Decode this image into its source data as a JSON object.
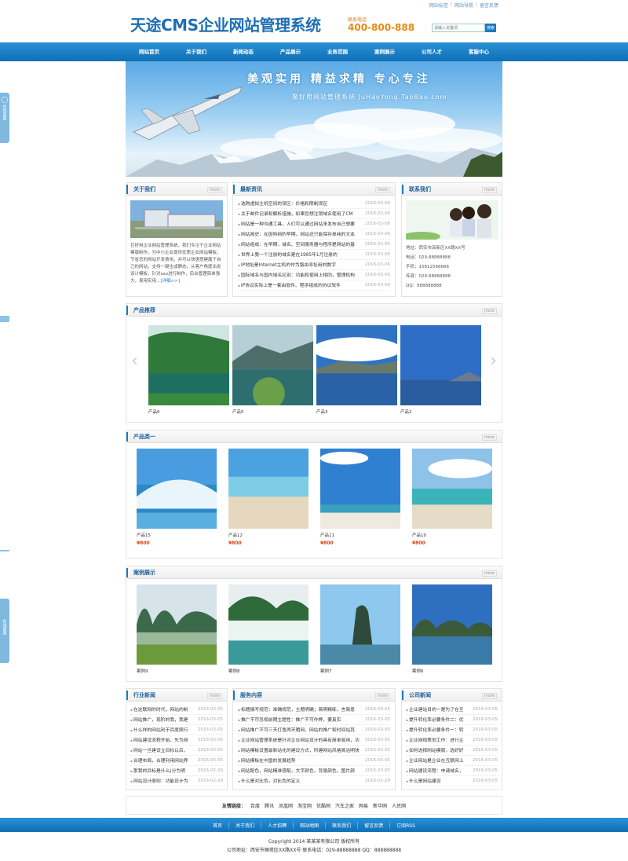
{
  "header": {
    "top_links": [
      "网站标签",
      "网站导航",
      "留言反馈"
    ],
    "logo": "天途CMS企业网站管理系统",
    "contact_label": "联系电话",
    "contact_phone": "400-800-888",
    "search_placeholder": "请输入关键词",
    "search_button": "搜索"
  },
  "nav": [
    "网站首页",
    "关于我们",
    "新闻动态",
    "产品展示",
    "业务范围",
    "案例展示",
    "公司人才",
    "客服中心"
  ],
  "banner": {
    "slogan": "美观实用  精益求精  专心专注",
    "sub": "聚好用网站管理系统  JuHaoYong.TaoBao.com"
  },
  "side_tabs": [
    "在线客服",
    "在线客服"
  ],
  "about": {
    "title": "关于我们",
    "more": "more",
    "text": "巨好用企业网站管理系统，我们专注于企业网站模版制作，为中小企业提供优质企业网站模板，节省您的网站开发费用，并可以快速搭建属于自己的网站，支持一键生成静态，从客户角度出发设计模板，针对seo进行制作，后台管理简单强大，易用实用…",
    "detail": "[详细>>]"
  },
  "news": {
    "title": "最新资讯",
    "more": "more",
    "items": [
      {
        "t": "选购虚拟主机空间的误区：价格和限制误区",
        "d": "2016-03-06"
      },
      {
        "t": "关于邮件记录和解析措施，如果您想注销域名使用了CM",
        "d": "2016-03-06"
      },
      {
        "t": "网站是一种沟通工具，人们可以通过网站来发布自己想要",
        "d": "2016-03-06"
      },
      {
        "t": "网站简史：在因特网的早期，网站还只能保存单纯的文本",
        "d": "2016-03-06"
      },
      {
        "t": "网站组成：在早期，域名、空间服务器与程序是网站的基",
        "d": "2016-03-06"
      },
      {
        "t": "世界上第一个注册的域名是在1985年1月注册的",
        "d": "2016-03-06"
      },
      {
        "t": "IP地址是Internet主机的作为路由寻址用的数字",
        "d": "2016-03-06"
      },
      {
        "t": "国际域名与国内域名区别：功能和使用上相同，管理机构",
        "d": "2016-03-06"
      },
      {
        "t": "IP协议实际上是一套由软件、程序组成的协议软件",
        "d": "2016-03-06"
      }
    ]
  },
  "contact": {
    "title": "联系我们",
    "more": "more",
    "lines": [
      "地址：西安市高新区XX路XX号",
      "电话：029-88888888",
      "手机：15612566666",
      "传真：029-88888888",
      "QQ：888888888"
    ]
  },
  "products_rec": {
    "title": "产品推荐",
    "more": "more",
    "items": [
      "产品6",
      "产品5",
      "产品3",
      "产品2"
    ]
  },
  "category1": {
    "title": "产品类一",
    "more": "more",
    "items": [
      {
        "name": "产品15",
        "price": "¥800"
      },
      {
        "name": "产品12",
        "price": "¥800"
      },
      {
        "name": "产品11",
        "price": "¥800"
      },
      {
        "name": "产品10",
        "price": "¥800"
      }
    ]
  },
  "cases": {
    "title": "案例展示",
    "more": "more",
    "items": [
      "案例9",
      "案例8",
      "案例7",
      "案例6"
    ]
  },
  "industry_news": {
    "title": "行业新闻",
    "more": "more",
    "items": [
      {
        "t": "在这联网的时代，网站的制",
        "d": "2016-03-05"
      },
      {
        "t": "网站推广，现阶的我，我是",
        "d": "2016-03-05"
      },
      {
        "t": "什么样的网站利于百度爬行",
        "d": "2016-03-05"
      },
      {
        "t": "网站建设流程开始，先为网",
        "d": "2016-03-05"
      },
      {
        "t": "网站一旦建设立目标以后，",
        "d": "2016-03-05"
      },
      {
        "t": "合理布局，合理利用网站界",
        "d": "2016-03-05"
      },
      {
        "t": "那我的目标是什么(分为明",
        "d": "2016-02-29"
      },
      {
        "t": "网站设计原则：功能设计为",
        "d": "2016-02-29"
      }
    ]
  },
  "service": {
    "title": "服务内容",
    "more": "more",
    "items": [
      {
        "t": "标题撰写规范：准确规范，主题明确；简明精练，言简意",
        "d": "2016-03-05"
      },
      {
        "t": "推广不可忽视前期主题性：推广不可作弊，要真实",
        "d": "2016-03-05"
      },
      {
        "t": "网站推广不可三天打鱼两天晒网，网站的推广和时间站其",
        "d": "2016-03-05"
      },
      {
        "t": "企业网站管理系统是针对企业网站设计的具有简单易用，功",
        "d": "2016-03-05"
      },
      {
        "t": "网站模板设置最新站化的建设方式，所建网站风格简洁明快",
        "d": "2016-03-05"
      },
      {
        "t": "网站模板在中国的发展趋势",
        "d": "2016-03-05"
      },
      {
        "t": "网站配色，网站精准搭配，文字颜色，背景颜色，图片颜",
        "d": "2016-03-05"
      },
      {
        "t": "什么是对比色，对比色的定义",
        "d": "2016-02-29"
      }
    ]
  },
  "company_news": {
    "title": "公司新闻",
    "more": "more",
    "items": [
      {
        "t": "企业建站目的一是为了在互",
        "d": "2016-03-05"
      },
      {
        "t": "提升转化率必要条件二：优",
        "d": "2016-03-05"
      },
      {
        "t": "提升转化率必要条件一：转",
        "d": "2016-03-05"
      },
      {
        "t": "企业网络策划工作：进行企",
        "d": "2016-03-05"
      },
      {
        "t": "如何选择网站模版，选好好",
        "d": "2016-03-05"
      },
      {
        "t": "企业网站是企业在互联网上",
        "d": "2016-03-05"
      },
      {
        "t": "网站建设流程：申请域名，",
        "d": "2016-03-05"
      },
      {
        "t": "什么是网站建设",
        "d": "2016-03-05"
      }
    ]
  },
  "friend_links": {
    "label": "友情链接：",
    "items": [
      "百度",
      "腾讯",
      "凤凰网",
      "淘宝网",
      "优酷网",
      "汽车之家",
      "网易",
      "新华网",
      "人民网"
    ]
  },
  "footer_nav": [
    "首页",
    "关于我们",
    "人才招聘",
    "网站地图",
    "联系我们",
    "留言反馈",
    "订阅RSS"
  ],
  "copyright": "Copyright 2014 某某某有限公司 版权所有",
  "address": "公司地址：西安市雁塔区XX路XX号 联系电话：029-88888888 QQ：888888888",
  "colors": {
    "primary": "#1b79c0",
    "title": "#1d5f9c",
    "price": "#e04010",
    "phone": "#e88a10"
  }
}
